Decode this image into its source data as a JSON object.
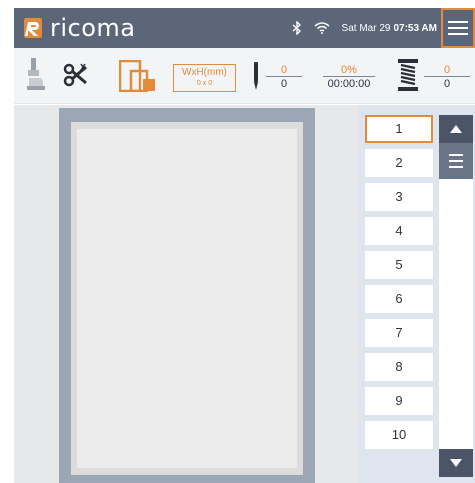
{
  "header": {
    "brand": "ricoma",
    "datetime": "Sat Mar 29",
    "time": "07:53 AM",
    "icons": [
      "bluetooth-icon",
      "wifi-icon",
      "menu-icon"
    ]
  },
  "toolbar": {
    "tools": [
      "presser-foot-icon",
      "thread-trim-icon",
      "hoop-size-icon"
    ],
    "size_label": "WxH(mm)",
    "size_value": "0 x 0",
    "stitch": {
      "top": "0",
      "bottom": "0"
    },
    "progress": {
      "top": "0%",
      "bottom": "00:00:00"
    },
    "bobbin": {
      "top": "0",
      "bottom": "0"
    }
  },
  "list": {
    "items": [
      "1",
      "2",
      "3",
      "4",
      "5",
      "6",
      "7",
      "8",
      "9",
      "10"
    ],
    "selected_index": 0
  },
  "colors": {
    "accent": "#e38b3c",
    "header": "#5b6678",
    "hoop": "#9ca7b5"
  }
}
